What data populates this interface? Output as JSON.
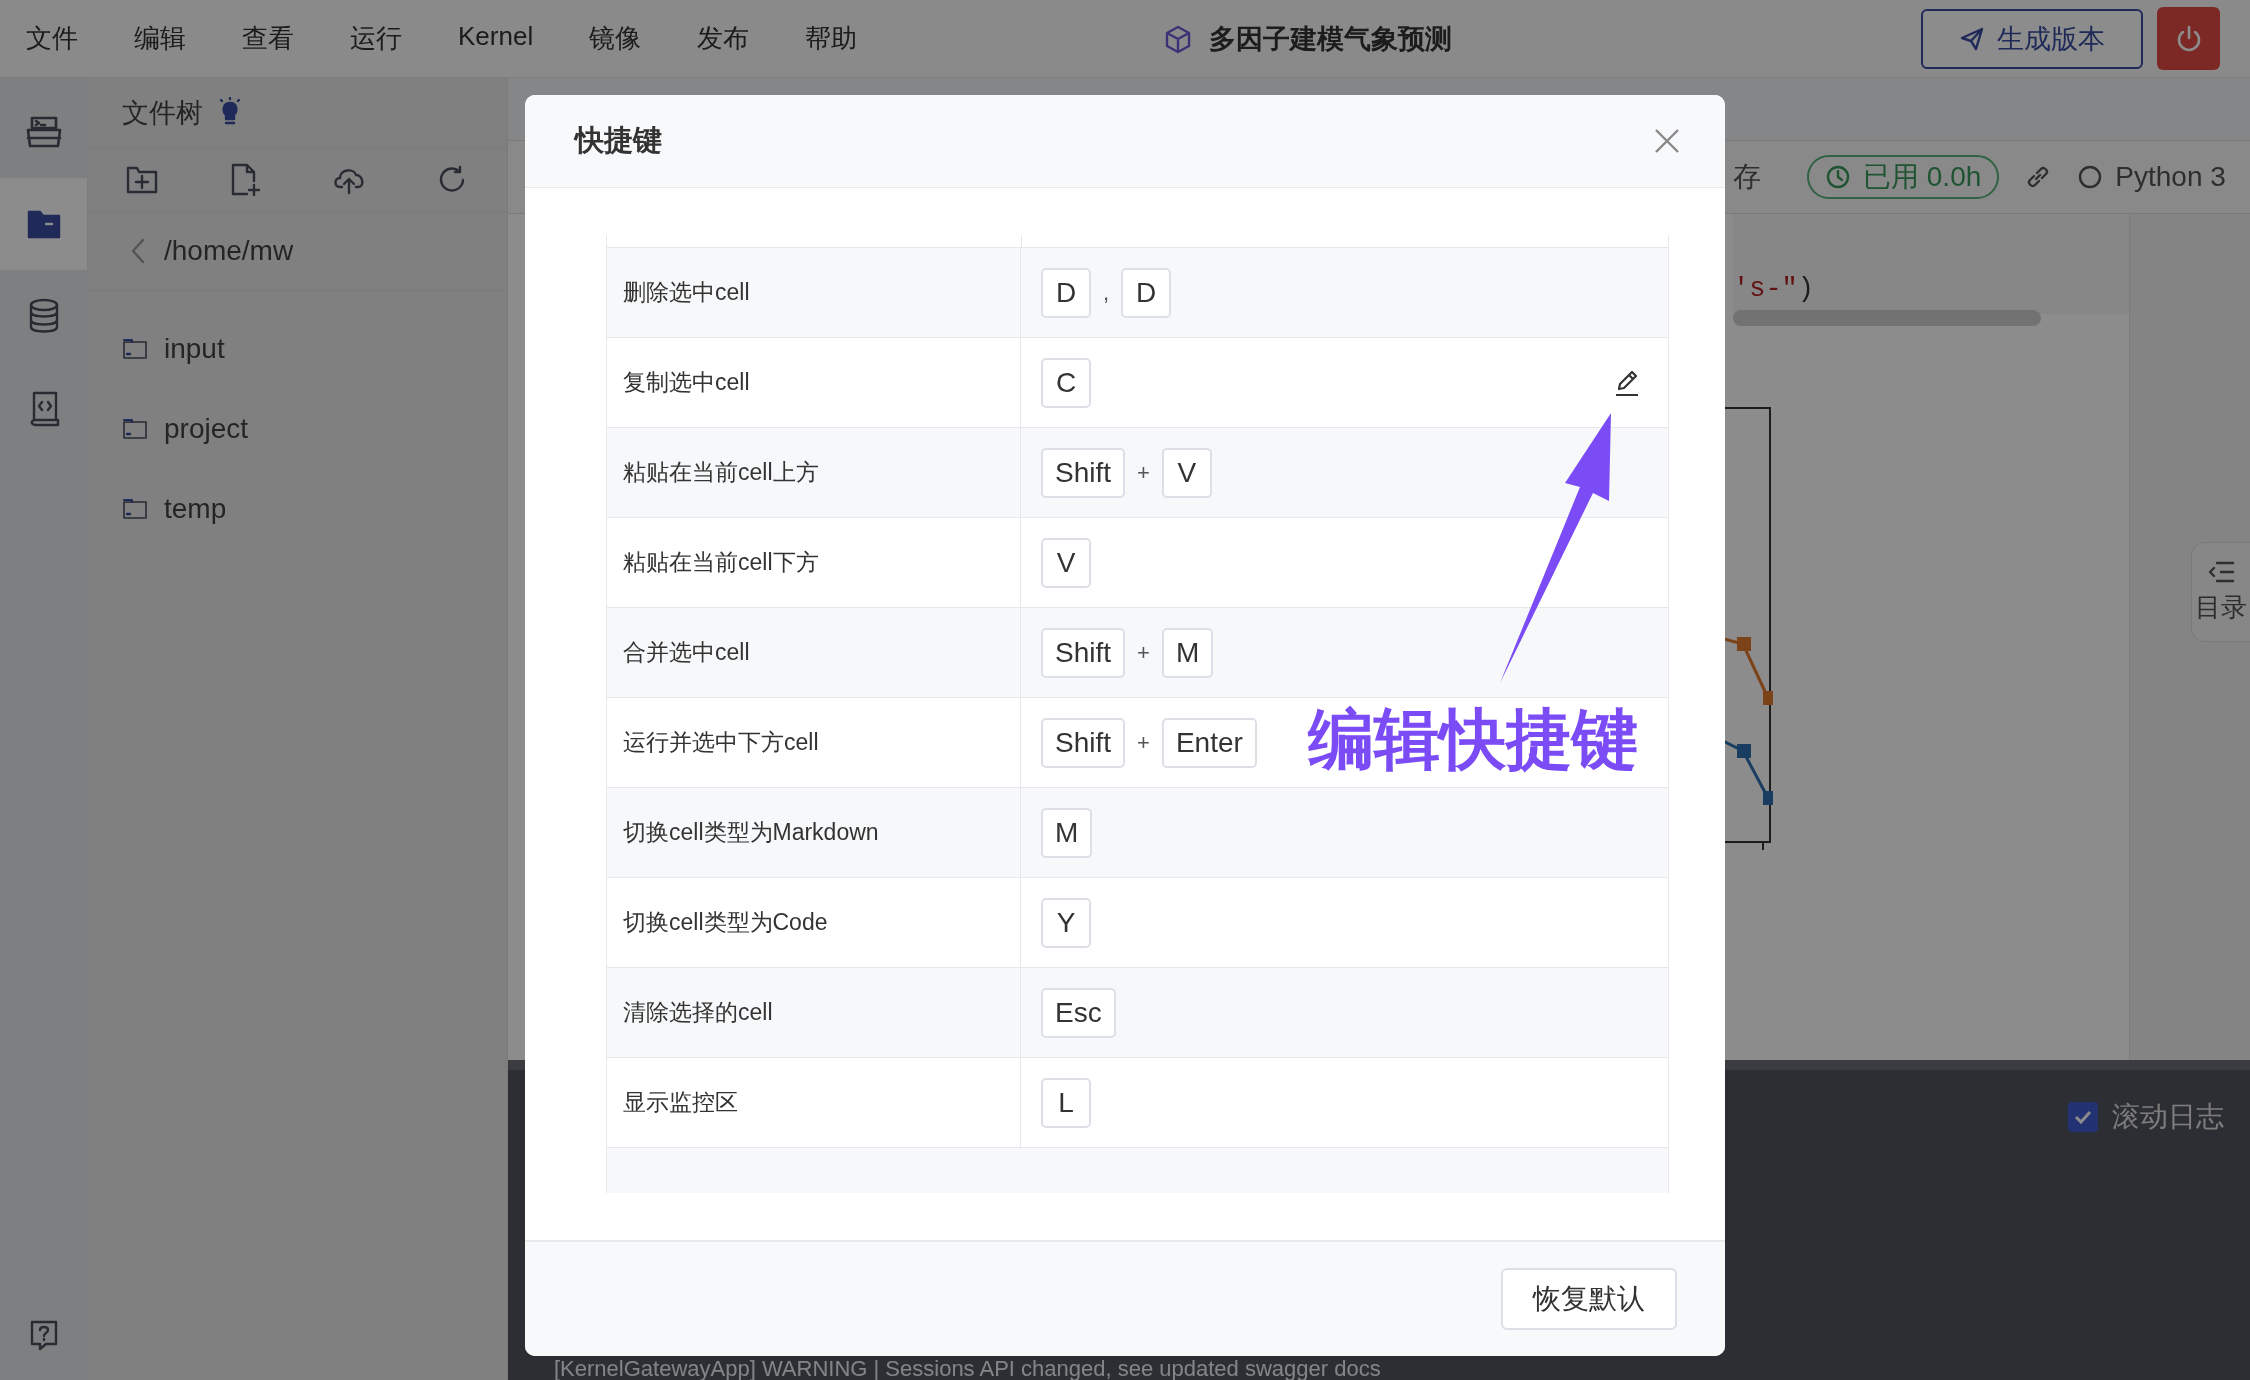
{
  "menu": [
    "文件",
    "编辑",
    "查看",
    "运行",
    "Kernel",
    "镜像",
    "发布",
    "帮助"
  ],
  "project_title": "多因子建模气象预测",
  "publish_button": "生成版本",
  "rail": [
    {
      "selected": false
    },
    {
      "selected": true
    },
    {
      "selected": false
    },
    {
      "selected": false
    }
  ],
  "file_tree": {
    "title": "文件树",
    "path": "/home/mw",
    "items": [
      "input",
      "project",
      "temp"
    ]
  },
  "notebook": {
    "save_label": "存",
    "usage": "已用 0.0h",
    "kernel": "Python 3",
    "code_string": "'s-\"",
    "code_rest": ")"
  },
  "toc_label": "目录",
  "log": {
    "autoscroll_label": "滚动日志",
    "autoscroll_checked": true,
    "lines": [
      "[KernelGatewayApp] WARNING | Sessions API changed, see updated swagger docs"
    ]
  },
  "dialog": {
    "title": "快捷键",
    "rows": [
      {
        "action": "删除选中cell",
        "keys": [
          "D",
          "D"
        ],
        "joiner": ",",
        "hovered": false
      },
      {
        "action": "复制选中cell",
        "keys": [
          "C"
        ],
        "hovered": true
      },
      {
        "action": "粘贴在当前cell上方",
        "keys": [
          "Shift",
          "V"
        ],
        "joiner": "+",
        "hovered": false
      },
      {
        "action": "粘贴在当前cell下方",
        "keys": [
          "V"
        ],
        "hovered": false
      },
      {
        "action": "合并选中cell",
        "keys": [
          "Shift",
          "M"
        ],
        "joiner": "+",
        "hovered": false
      },
      {
        "action": "运行并选中下方cell",
        "keys": [
          "Shift",
          "Enter"
        ],
        "joiner": "+",
        "hovered": false
      },
      {
        "action": "切换cell类型为Markdown",
        "keys": [
          "M"
        ],
        "hovered": false
      },
      {
        "action": "切换cell类型为Code",
        "keys": [
          "Y"
        ],
        "hovered": false
      },
      {
        "action": "清除选择的cell",
        "keys": [
          "Esc"
        ],
        "hovered": false
      },
      {
        "action": "显示监控区",
        "keys": [
          "L"
        ],
        "hovered": false
      }
    ],
    "annotation": "编辑快捷键",
    "reset_button": "恢复默认"
  }
}
